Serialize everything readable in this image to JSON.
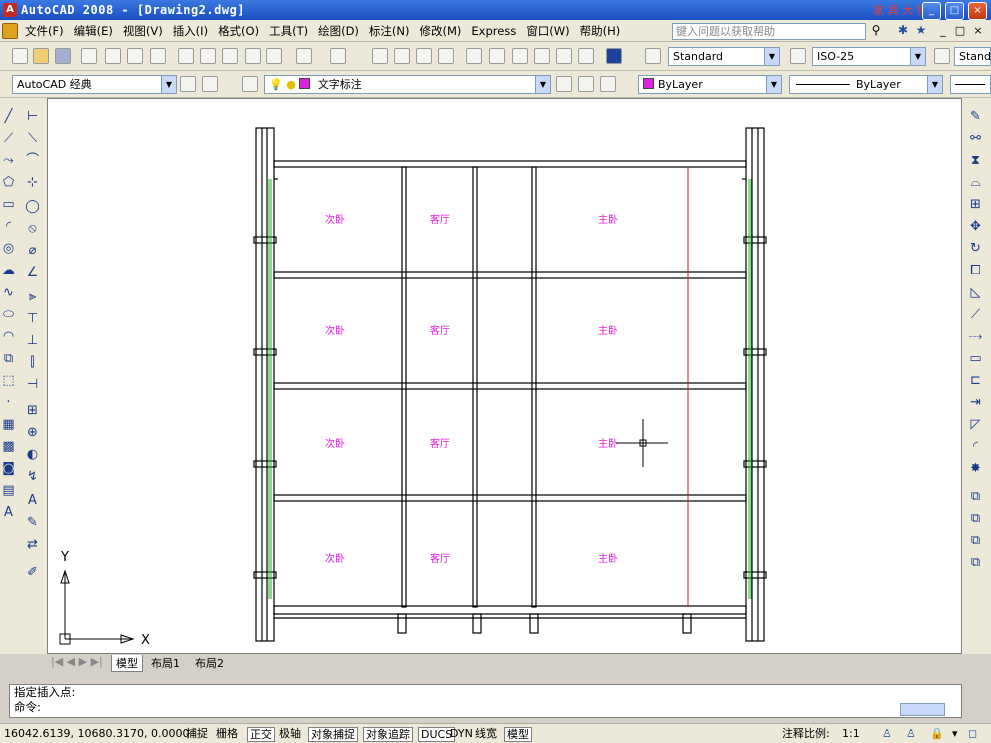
{
  "window": {
    "title": "AutoCAD 2008 - [Drawing2.dwg]",
    "watermark": "家 具 大 师 网",
    "app_icon": "A",
    "controls": [
      "_",
      "□",
      "×"
    ]
  },
  "menubar": {
    "items": [
      "文件(F)",
      "编辑(E)",
      "视图(V)",
      "插入(I)",
      "格式(O)",
      "工具(T)",
      "绘图(D)",
      "标注(N)",
      "修改(M)",
      "Express",
      "窗口(W)",
      "帮助(H)"
    ],
    "help_placeholder": "键入问题以获取帮助",
    "doc_controls": [
      "_",
      "□",
      "×"
    ]
  },
  "toolbar": {
    "text_style": "Standard",
    "dim_style": "ISO-25",
    "table_style": "Stand",
    "workspace": "AutoCAD 经典",
    "layer": "文字标注",
    "color": "ByLayer",
    "linetype": "ByLayer"
  },
  "drawing": {
    "rooms": [
      [
        "次卧",
        "客厅",
        "主卧"
      ],
      [
        "次卧",
        "客厅",
        "主卧"
      ],
      [
        "次卧",
        "客厅",
        "主卧"
      ],
      [
        "次卧",
        "客厅",
        "主卧"
      ]
    ],
    "ucs_x": "X",
    "ucs_y": "Y",
    "colors": {
      "room_label": "#e020e0",
      "red_line": "#d02020",
      "green_line": "#20b020"
    }
  },
  "tabs": [
    "模型",
    "布局1",
    "布局2"
  ],
  "command": {
    "line1": "指定插入点:",
    "line2": "命令:"
  },
  "status": {
    "coords": "16042.6139, 10680.3170, 0.0000",
    "buttons": [
      "捕捉",
      "栅格",
      "正交",
      "极轴",
      "对象捕捉",
      "对象追踪",
      "DUCS",
      "DYN",
      "线宽",
      "模型"
    ],
    "annot_scale_label": "注释比例:",
    "annot_scale": "1:1"
  }
}
